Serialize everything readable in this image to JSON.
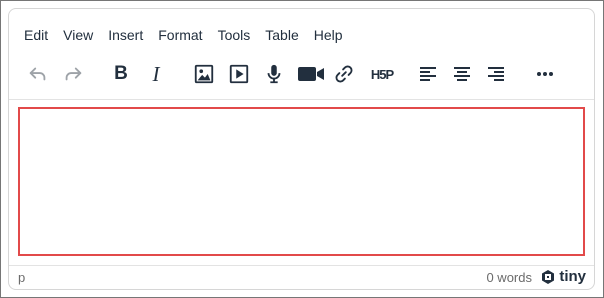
{
  "menubar": {
    "items": [
      "Edit",
      "View",
      "Insert",
      "Format",
      "Tools",
      "Table",
      "Help"
    ]
  },
  "toolbar": {
    "buttons": [
      {
        "icon": "undo-icon",
        "state": "disabled"
      },
      {
        "icon": "redo-icon",
        "state": "disabled"
      },
      {
        "icon": "bold-icon",
        "label": "B"
      },
      {
        "icon": "italic-icon",
        "label": "I"
      },
      {
        "icon": "image-icon"
      },
      {
        "icon": "media-play-icon"
      },
      {
        "icon": "microphone-icon"
      },
      {
        "icon": "video-camera-icon"
      },
      {
        "icon": "link-icon"
      },
      {
        "icon": "h5p-icon",
        "label": "H5P"
      },
      {
        "icon": "align-left-icon"
      },
      {
        "icon": "align-center-icon"
      },
      {
        "icon": "align-right-icon"
      },
      {
        "icon": "more-icon"
      }
    ]
  },
  "statusbar": {
    "path": "p",
    "wordcount": "0 words",
    "brand": "tiny"
  },
  "colors": {
    "icon": "#222f3e",
    "disabled_icon": "#9ea3a8",
    "content_border": "#e24a4a",
    "statusbar_text": "#6b6b6b"
  }
}
